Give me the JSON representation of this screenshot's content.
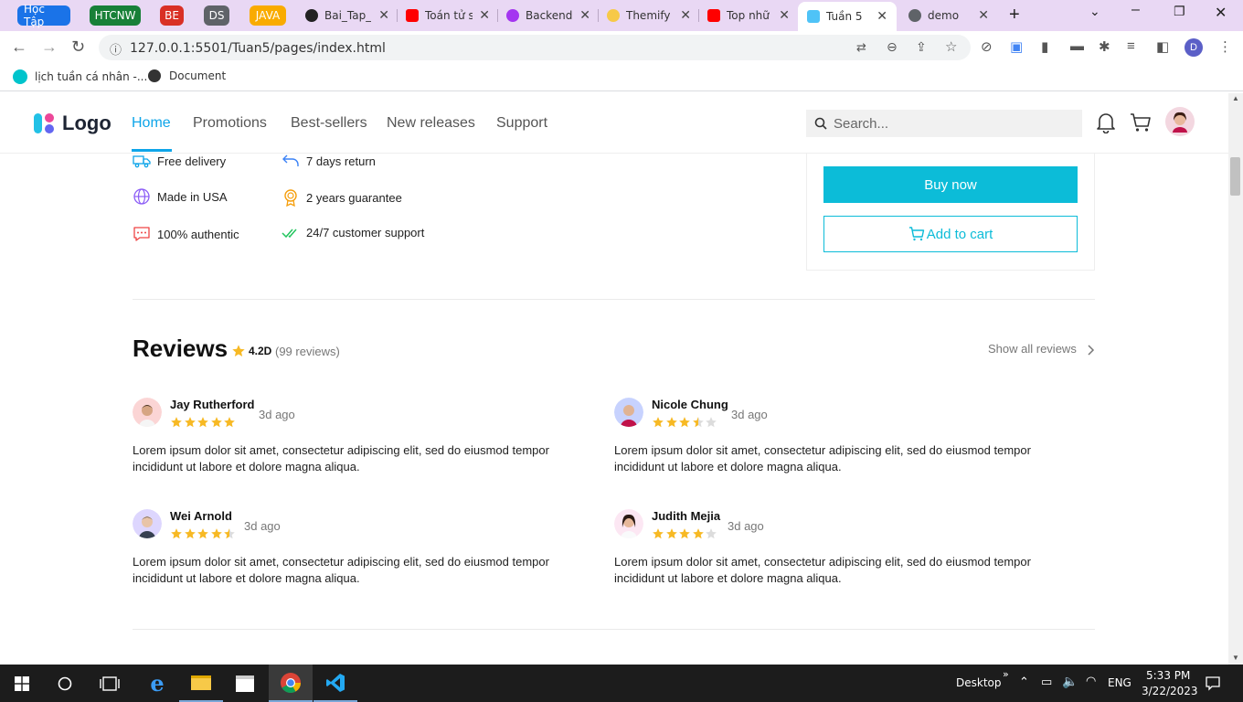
{
  "browser": {
    "tab_groups": [
      {
        "label": "Học Tập",
        "color": "#1a73e8"
      },
      {
        "label": "HTCNW",
        "color": "#188038"
      },
      {
        "label": "BE",
        "color": "#d93025"
      },
      {
        "label": "DS",
        "color": "#5f6368"
      },
      {
        "label": "JAVA",
        "color": "#f9ab00"
      }
    ],
    "tabs": [
      {
        "title": "Bai_Tap_",
        "icon": "github-icon"
      },
      {
        "title": "Toán tử s",
        "icon": "youtube-icon"
      },
      {
        "title": "Backend",
        "icon": "udemy-icon"
      },
      {
        "title": "Themify",
        "icon": "emoji-icon"
      },
      {
        "title": "Top nhữ",
        "icon": "youtube-icon"
      },
      {
        "title": "Tuần 5",
        "icon": "bus-icon",
        "active": true
      },
      {
        "title": "demo",
        "icon": "globe-icon"
      }
    ],
    "url": "127.0.0.1:5501/Tuan5/pages/index.html",
    "profile_initial": "D",
    "bookmarks": [
      {
        "label": "lịch tuần cá nhân -...",
        "icon": "canva-icon"
      },
      {
        "label": "Document",
        "icon": "globe-icon"
      }
    ]
  },
  "header": {
    "logo": "Logo",
    "nav": [
      {
        "label": "Home",
        "active": true
      },
      {
        "label": "Promotions"
      },
      {
        "label": "Best-sellers"
      },
      {
        "label": "New releases"
      },
      {
        "label": "Support"
      }
    ],
    "search_placeholder": "Search..."
  },
  "features": [
    {
      "label": "Free delivery",
      "icon": "truck-icon"
    },
    {
      "label": "7 days return",
      "icon": "return-icon"
    },
    {
      "label": "Made in USA",
      "icon": "globe-icon"
    },
    {
      "label": "2 years guarantee",
      "icon": "medal-icon"
    },
    {
      "label": "100% authentic",
      "icon": "chat-icon"
    },
    {
      "label": "24/7 customer support",
      "icon": "double-check-icon"
    }
  ],
  "purchase": {
    "buy_now": "Buy now",
    "add_to_cart": "Add to cart"
  },
  "reviews": {
    "title": "Reviews",
    "rating": "4.2D",
    "count": "(99 reviews)",
    "show_all": "Show all reviews",
    "items": [
      {
        "name": "Jay Rutherford",
        "ago": "3d ago",
        "stars": 5,
        "text": "Lorem ipsum dolor sit amet, consectetur adipiscing elit, sed do eiusmod tempor incididunt ut labore et dolore magna aliqua."
      },
      {
        "name": "Nicole Chung",
        "ago": "3d ago",
        "stars": 3.5,
        "text": "Lorem ipsum dolor sit amet, consectetur adipiscing elit, sed do eiusmod tempor incididunt ut labore et dolore magna aliqua."
      },
      {
        "name": "Wei Arnold",
        "ago": "3d ago",
        "stars": 4.5,
        "text": "Lorem ipsum dolor sit amet, consectetur adipiscing elit, sed do eiusmod tempor incididunt ut labore et dolore magna aliqua."
      },
      {
        "name": "Judith Mejia",
        "ago": "3d ago",
        "stars": 4,
        "text": "Lorem ipsum dolor sit amet, consectetur adipiscing elit, sed do eiusmod tempor incididunt ut labore et dolore magna aliqua."
      }
    ]
  },
  "taskbar": {
    "desktop_label": "Desktop",
    "language": "ENG",
    "time": "5:33 PM",
    "date": "3/22/2023"
  },
  "colors": {
    "accent": "#0ea5e9",
    "button": "#0cbcd8",
    "star": "#f7b924",
    "tabstrip": "#e9d8f4"
  }
}
